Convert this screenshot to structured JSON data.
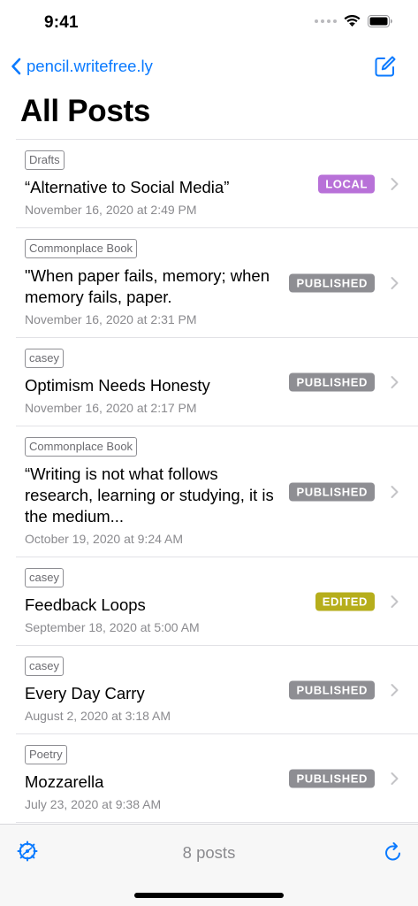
{
  "status_bar": {
    "time": "9:41"
  },
  "nav": {
    "back_label": "pencil.writefree.ly"
  },
  "page": {
    "title": "All Posts"
  },
  "badge_colors": {
    "LOCAL": "#b871d8",
    "PUBLISHED": "#8e8e93",
    "EDITED": "#b6ae1c"
  },
  "posts": [
    {
      "collection": "Drafts",
      "title": "“Alternative to Social Media”",
      "date": "November 16, 2020 at 2:49 PM",
      "status": "LOCAL"
    },
    {
      "collection": "Commonplace Book",
      "title": "\"When paper fails, memory; when memory fails, paper.",
      "date": "November 16, 2020 at 2:31 PM",
      "status": "PUBLISHED"
    },
    {
      "collection": "casey",
      "title": "Optimism Needs Honesty",
      "date": "November 16, 2020 at 2:17 PM",
      "status": "PUBLISHED"
    },
    {
      "collection": "Commonplace Book",
      "title": "“Writing is not what follows research, learning or studying, it is the medium...",
      "date": "October 19, 2020 at 9:24 AM",
      "status": "PUBLISHED"
    },
    {
      "collection": "casey",
      "title": "Feedback Loops",
      "date": "September 18, 2020 at 5:00 AM",
      "status": "EDITED"
    },
    {
      "collection": "casey",
      "title": "Every Day Carry",
      "date": "August 2, 2020 at 3:18 AM",
      "status": "PUBLISHED"
    },
    {
      "collection": "Poetry",
      "title": "Mozzarella",
      "date": "July 23, 2020 at 9:38 AM",
      "status": "PUBLISHED"
    }
  ],
  "toolbar": {
    "post_count": "8 posts"
  }
}
